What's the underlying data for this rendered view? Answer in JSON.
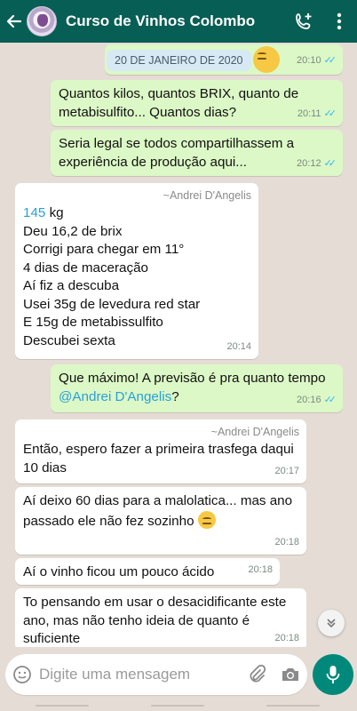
{
  "header": {
    "title": "Curso de Vinhos Colombo",
    "back_icon": "arrow-left-icon",
    "add_call_icon": "phone-plus-icon",
    "menu_icon": "more-vert-icon"
  },
  "date_chip": "20 DE JANEIRO DE 2020",
  "messages": [
    {
      "dir": "out",
      "text": "Quantos kilos, quantos BRIX,  quanto de metabisulfito... Quantos dias?",
      "time": "20:11"
    },
    {
      "dir": "out",
      "text": "Seria legal se todos compartilhassem a experiência de produção aqui...",
      "time": "20:12"
    },
    {
      "dir": "in",
      "sender": "~Andrei D'Angelis",
      "lines": [
        "145",
        " kg",
        "Deu 16,2 de brix",
        "Corrigi para chegar em 11°",
        "4 dias de maceração",
        "Aí fiz a descuba",
        "Usei 35g de levedura red star",
        "E 15g de metabissulfito",
        "Descubei sexta"
      ],
      "time": "20:14"
    },
    {
      "dir": "out",
      "text": "Que máximo! A previsão é pra quanto tempo ",
      "mention": "@Andrei D'Angelis",
      "after": "?",
      "time": "20:16"
    },
    {
      "dir": "in",
      "sender": "~Andrei D'Angelis",
      "text": "Então, espero fazer a primeira trasfega daqui 10 dias",
      "time": "20:17"
    },
    {
      "dir": "in",
      "text": "Aí deixo 60 dias para a malolatica... mas ano passado ele não fez sozinho",
      "time": "20:18"
    },
    {
      "dir": "in",
      "text": "Aí o vinho ficou um pouco ácido",
      "time": "20:18"
    },
    {
      "dir": "in",
      "text": "To pensando em usar o desacidificante este ano, mas não tenho ideia de quanto é suficiente",
      "time": "20:18"
    }
  ],
  "first_time": "20:10",
  "input": {
    "placeholder": "Digite uma mensagem",
    "emoji_icon": "emoji-icon",
    "attach_icon": "paperclip-icon",
    "camera_icon": "camera-icon",
    "mic_icon": "mic-icon"
  },
  "scroll_icon": "double-chevron-down-icon",
  "colors": {
    "header": "#075e54",
    "outgoing": "#dcf8c6",
    "incoming": "#ffffff",
    "accent": "#00897b",
    "read_ticks": "#34b7f1"
  }
}
